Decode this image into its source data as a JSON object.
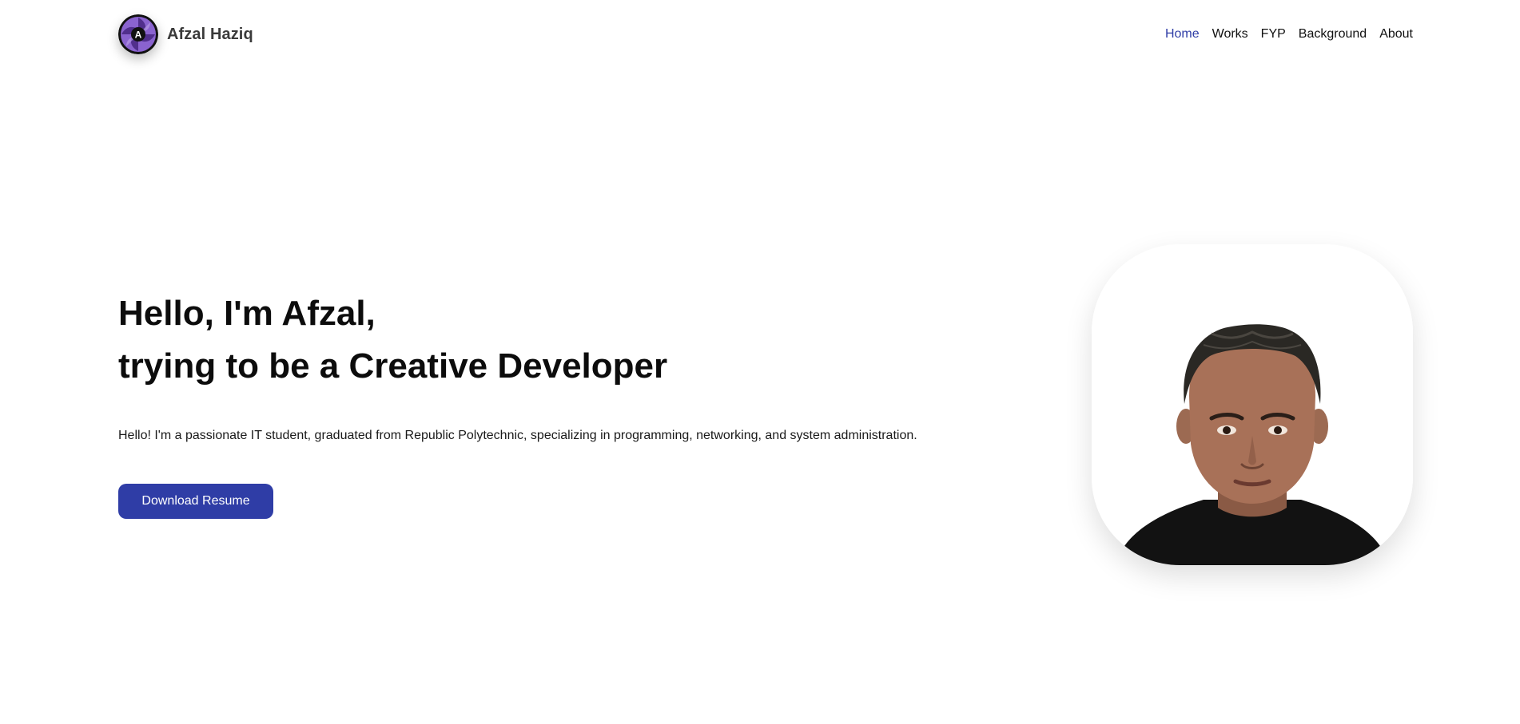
{
  "header": {
    "brand_name": "Afzal Haziq",
    "logo_letter": "A",
    "nav": [
      {
        "label": "Home",
        "active": true
      },
      {
        "label": "Works",
        "active": false
      },
      {
        "label": "FYP",
        "active": false
      },
      {
        "label": "Background",
        "active": false
      },
      {
        "label": "About",
        "active": false
      }
    ]
  },
  "hero": {
    "title_line1": "Hello, I'm Afzal,",
    "title_line2": "trying to be a Creative Developer",
    "description": "Hello! I'm a passionate IT student, graduated from Republic Polytechnic, specializing in programming, networking, and system administration.",
    "cta_label": "Download Resume"
  },
  "portrait": {
    "icon": "profile-photo"
  },
  "colors": {
    "accent": "#2f3da6",
    "text": "#111111",
    "background": "#ffffff",
    "logo_purple": "#7e57c2"
  }
}
